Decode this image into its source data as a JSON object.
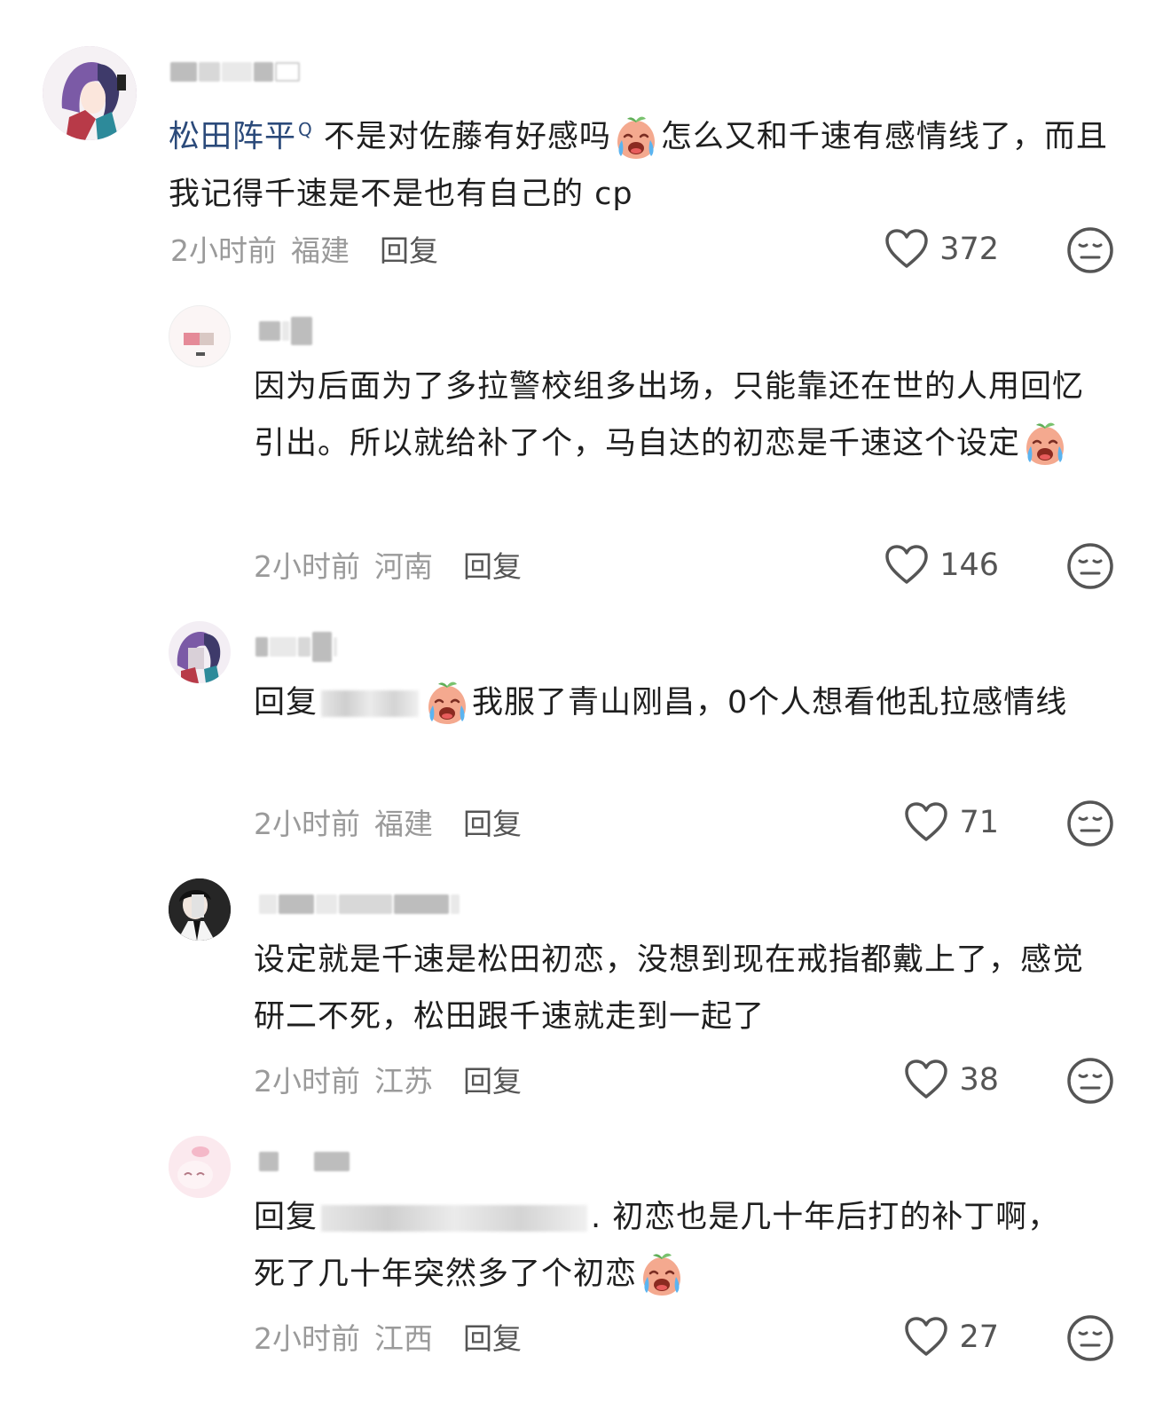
{
  "comments": [
    {
      "mention": "松田阵平",
      "mention_sup": "Q",
      "text_a": "不是对佐藤有好感吗",
      "text_b": "怎么又和千速有感情线了，而且我记得千速是不是也有自己的 cp",
      "time": "2小时前",
      "region": "福建",
      "reply": "回复",
      "likes": "372"
    },
    {
      "text_a": "因为后面为了多拉警校组多出场，只能靠还在世的人用回忆引出。所以就给补了个，马自达的初恋是千速这个设定",
      "time": "2小时前",
      "region": "河南",
      "reply": "回复",
      "likes": "146"
    },
    {
      "reply_prefix": "回复",
      "text_a": "我服了青山刚昌，0个人想看他乱拉感情线",
      "time": "2小时前",
      "region": "福建",
      "reply": "回复",
      "likes": "71"
    },
    {
      "text_a": "设定就是千速是松田初恋，没想到现在戒指都戴上了，感觉研二不死，松田跟千速就走到一起了",
      "time": "2小时前",
      "region": "江苏",
      "reply": "回复",
      "likes": "38"
    },
    {
      "reply_prefix": "回复",
      "text_a": ". 初恋也是几十年后打的补丁啊，死了几十年突然多了个初恋",
      "time": "2小时前",
      "region": "江西",
      "reply": "回复",
      "likes": "27"
    }
  ],
  "icons": {
    "like": "heart-outline-icon",
    "dislike": "neutral-face-icon",
    "emoji": "crying-peach-emoji"
  },
  "colors": {
    "text": "#1f1f1f",
    "mention": "#2b4a7a",
    "meta": "#9a9a9a"
  }
}
